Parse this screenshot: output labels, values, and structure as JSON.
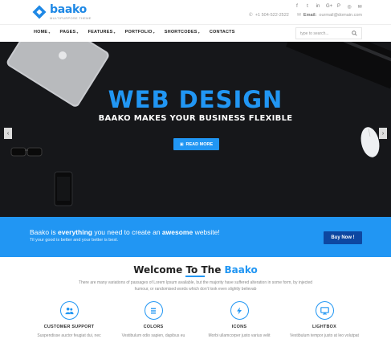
{
  "logo": {
    "name": "baako",
    "tagline": "MULTIPURPOSE THEME"
  },
  "social": [
    "f",
    "t",
    "in",
    "G+",
    "P",
    "◎",
    "✉"
  ],
  "contact": {
    "phone": "+1 504-522-2522",
    "email_label": "Email:",
    "email": "ourmail@domain.com"
  },
  "nav": {
    "items": [
      {
        "label": "HOME",
        "caret": "▾"
      },
      {
        "label": "PAGES",
        "caret": "▾"
      },
      {
        "label": "FEATURES",
        "caret": "▾"
      },
      {
        "label": "PORTFOLIO",
        "caret": "▾"
      },
      {
        "label": "SHORTCODES",
        "caret": "▾"
      },
      {
        "label": "CONTACTS",
        "caret": ""
      }
    ],
    "search_placeholder": "type to search..."
  },
  "hero": {
    "title": "WEB DESIGN",
    "subtitle": "BAAKO MAKES YOUR BUSINESS FLEXIBLE",
    "button_label": "READ MORE",
    "prev_arrow": "‹",
    "next_arrow": "›"
  },
  "cta": {
    "pre": "Baako is ",
    "strong1": "everything",
    "mid": " you need to create an ",
    "strong2": "awesome",
    "post": " website!",
    "subline": "Til your good is better and your better is best.",
    "button_label": "Buy Now !"
  },
  "welcome": {
    "title_pre": "Welcome To The ",
    "title_accent": "Baako",
    "text": "There are many variations of passages of Lorem Ipsum available, but the majority have suffered alteration in some form, by injected humour, or randomised words which don't look even slightly believab"
  },
  "features": [
    {
      "title": "CUSTOMER SUPPORT",
      "desc": "Suspendisse auctor feugiat dui, nec",
      "icon": "users-icon"
    },
    {
      "title": "COLORS",
      "desc": "Vestibulum odio sapien, dapibus eu",
      "icon": "brush-icon"
    },
    {
      "title": "ICONS",
      "desc": "Morbi ullamcorper justo varius velit",
      "icon": "bolt-icon"
    },
    {
      "title": "LIGHTBOX",
      "desc": "Vestibulum tempor justo at leo volutpat",
      "icon": "monitor-icon"
    }
  ],
  "colors": {
    "accent": "#2196f3",
    "hero_bg": "#16171a",
    "cta_button": "#0d47a1"
  }
}
